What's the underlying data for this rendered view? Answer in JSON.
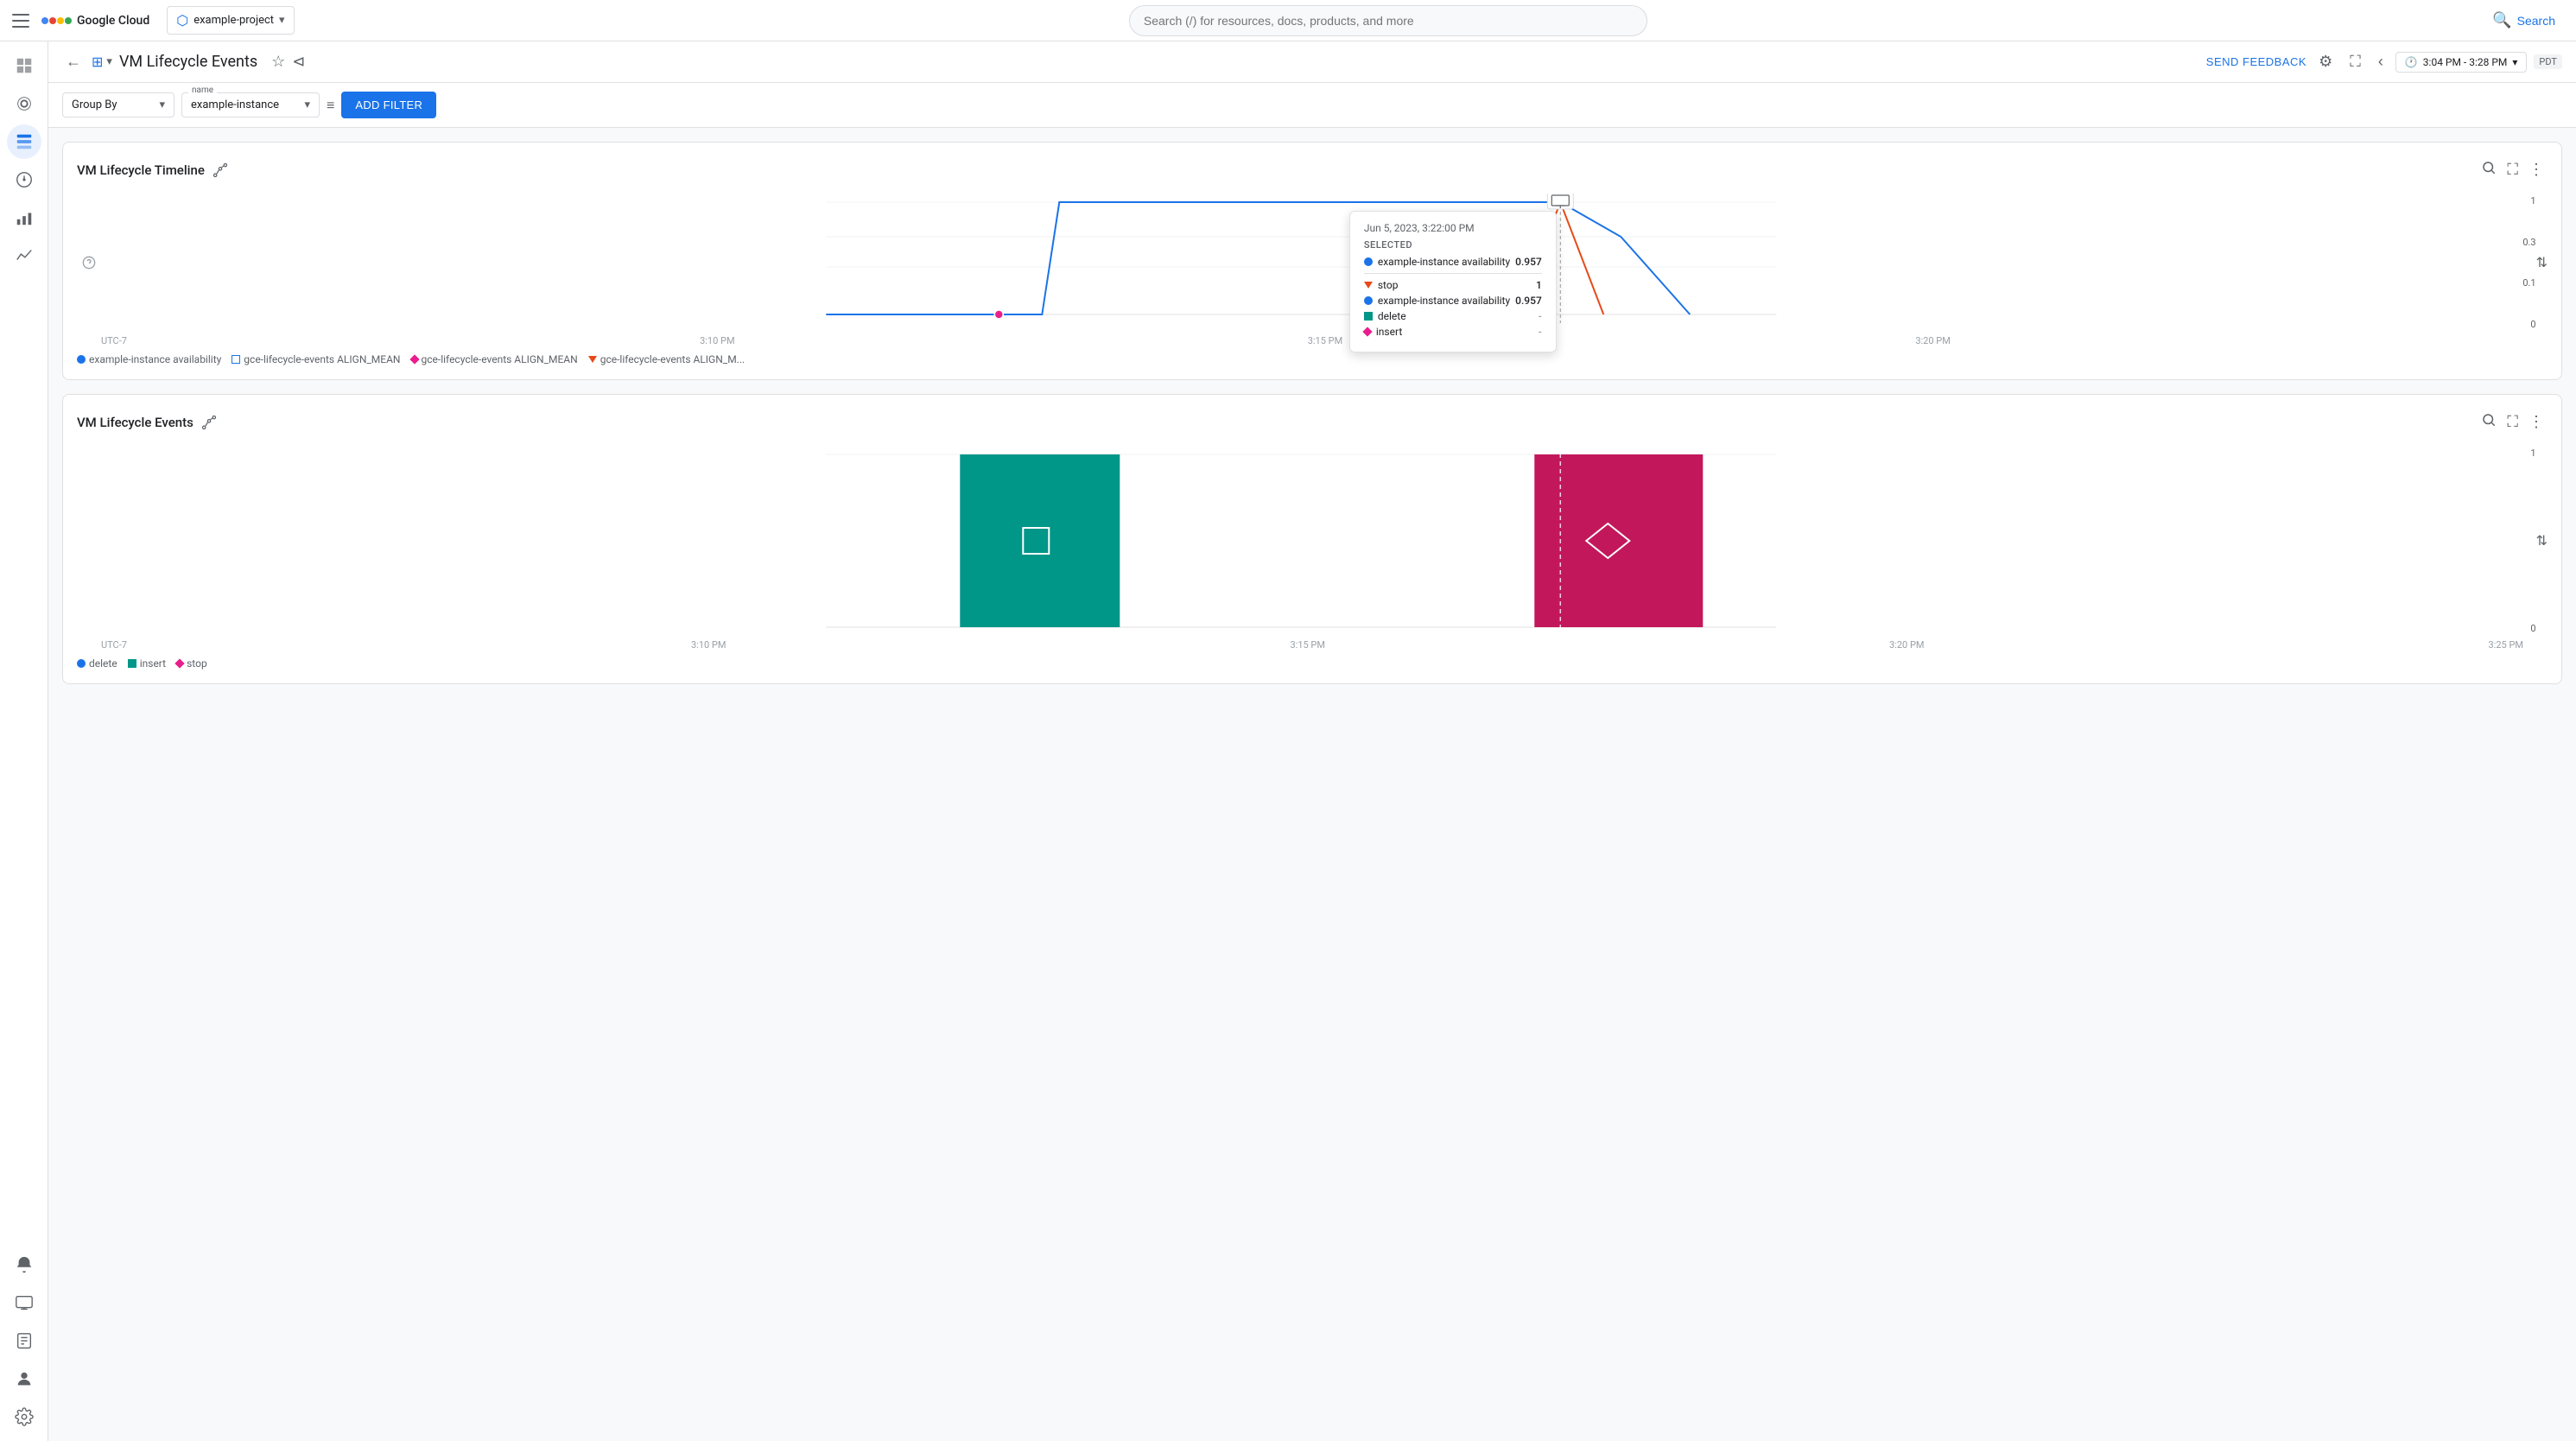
{
  "topbar": {
    "hamburger_label": "☰",
    "logo_text": "Google Cloud",
    "project": "example-project",
    "search_placeholder": "Search (/) for resources, docs, products, and more",
    "search_button_label": "Search"
  },
  "header": {
    "title": "VM Lifecycle Events",
    "feedback_label": "SEND FEEDBACK",
    "time_range": "3:04 PM - 3:28 PM",
    "timezone": "PDT"
  },
  "filter_bar": {
    "group_by_label": "Group By",
    "name_label": "name",
    "name_value": "example-instance",
    "add_filter_label": "ADD FILTER"
  },
  "chart1": {
    "title": "VM Lifecycle Timeline",
    "y_labels": [
      "1",
      "0.3",
      "0.1",
      "0"
    ],
    "x_labels": [
      "UTC-7",
      "3:10 PM",
      "3:15 PM",
      "3:20 PM"
    ],
    "legend": [
      {
        "label": "example-instance availability",
        "type": "dot",
        "color": "#1a73e8"
      },
      {
        "label": "gce-lifecycle-events ALIGN_MEAN",
        "type": "square",
        "color": "#1a73e8"
      },
      {
        "label": "gce-lifecycle-events ALIGN_MEAN",
        "type": "diamond",
        "color": "#e91e8c"
      },
      {
        "label": "gce-lifecycle-events ALIGN_M...",
        "type": "triangle",
        "color": "#e64a19"
      }
    ],
    "tooltip": {
      "date": "Jun 5, 2023, 3:22:00 PM",
      "selected_label": "SELECTED",
      "rows": [
        {
          "type": "dot",
          "color": "#1a73e8",
          "label": "example-instance availability",
          "value": "0.957"
        },
        {
          "type": "divider"
        },
        {
          "type": "triangle-down",
          "color": "#e64a19",
          "label": "stop",
          "value": "1"
        },
        {
          "type": "dot",
          "color": "#1a73e8",
          "label": "example-instance availability",
          "value": "0.957"
        },
        {
          "type": "square",
          "color": "#009688",
          "label": "delete",
          "value": "-"
        },
        {
          "type": "diamond",
          "color": "#e91e8c",
          "label": "insert",
          "value": "-"
        }
      ]
    }
  },
  "chart2": {
    "title": "VM Lifecycle Events",
    "x_labels": [
      "UTC-7",
      "3:10 PM",
      "3:15 PM",
      "3:20 PM",
      "3:25 PM"
    ],
    "y_labels": [
      "1",
      "0"
    ],
    "legend": [
      {
        "label": "delete",
        "type": "dot",
        "color": "#1a73e8"
      },
      {
        "label": "insert",
        "type": "square",
        "color": "#009688"
      },
      {
        "label": "stop",
        "type": "diamond",
        "color": "#e91e8c"
      }
    ]
  },
  "sidebar": {
    "items": [
      {
        "icon": "⊞",
        "label": "Dashboard",
        "active": false
      },
      {
        "icon": "◉",
        "label": "Monitoring",
        "active": false
      },
      {
        "icon": "≡",
        "label": "Events",
        "active": true
      },
      {
        "icon": "⌀",
        "label": "Alerts",
        "active": false
      },
      {
        "icon": "📊",
        "label": "Metrics",
        "active": false
      },
      {
        "icon": "〜",
        "label": "Traces",
        "active": false
      },
      {
        "icon": "🔔",
        "label": "Notifications",
        "active": false
      },
      {
        "icon": "🖥",
        "label": "VMs",
        "active": false
      },
      {
        "icon": "📋",
        "label": "Logs",
        "active": false
      },
      {
        "icon": "👤",
        "label": "User",
        "active": false
      },
      {
        "icon": "⚙",
        "label": "Settings",
        "active": false
      }
    ]
  }
}
